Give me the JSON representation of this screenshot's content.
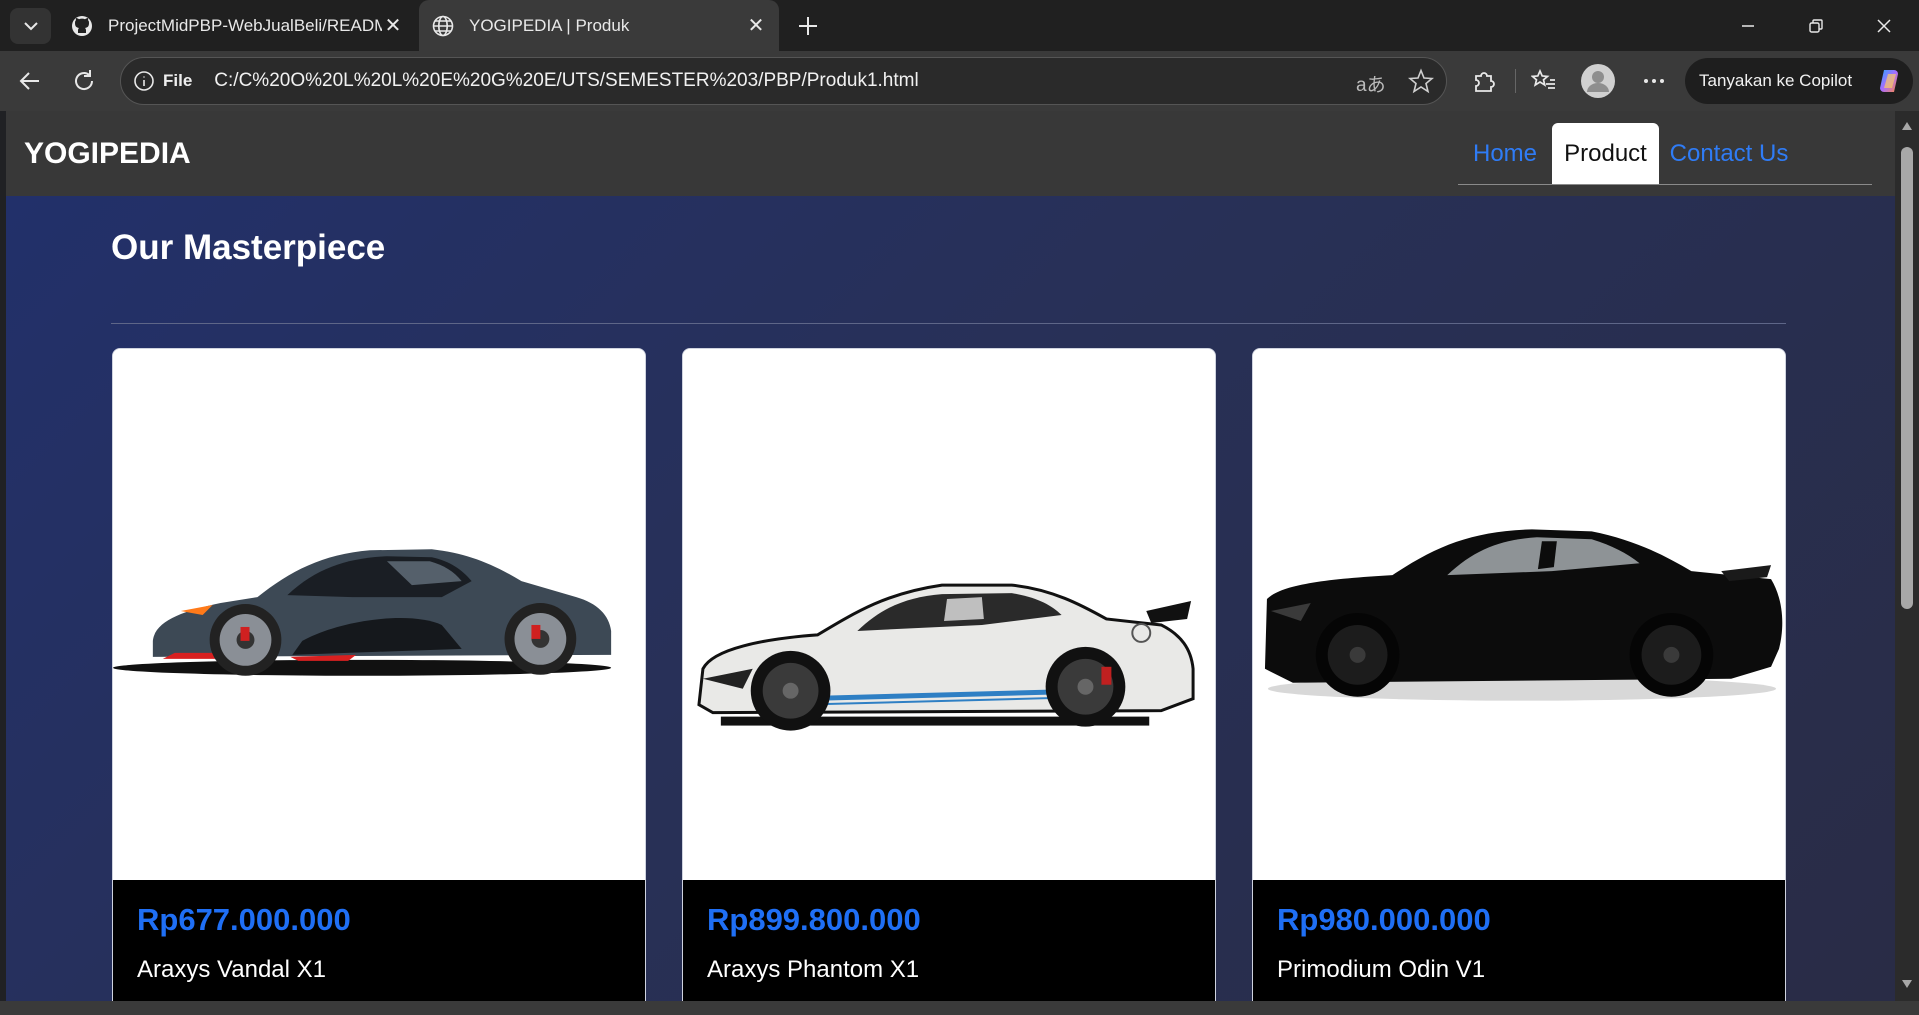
{
  "browser": {
    "tabs": [
      {
        "title": "ProjectMidPBP-WebJualBeli/README",
        "icon": "github-icon",
        "active": false
      },
      {
        "title": "YOGIPEDIA | Produk",
        "icon": "globe-icon",
        "active": true
      }
    ],
    "address": {
      "scheme_label": "File",
      "url": "C:/C%20O%20L%20L%20E%20G%20E/UTS/SEMESTER%203/PBP/Produk1.html"
    },
    "copilot_label": "Tanyakan ke Copilot"
  },
  "site": {
    "brand": "YOGIPEDIA",
    "nav": [
      {
        "label": "Home",
        "active": false
      },
      {
        "label": "Product",
        "active": true
      },
      {
        "label": "Contact Us",
        "active": false
      }
    ],
    "heading": "Our Masterpiece",
    "products": [
      {
        "price": "Rp677.000.000",
        "name": "Araxys Vandal X1",
        "image": "gray-hypercar-image"
      },
      {
        "price": "Rp899.800.000",
        "name": "Araxys Phantom X1",
        "image": "white-muscle-car-image"
      },
      {
        "price": "Rp980.000.000",
        "name": "Primodium Odin V1",
        "image": "black-coupe-image"
      }
    ]
  },
  "colors": {
    "accent": "#1f6ff5",
    "page_bg": "#27305a",
    "nav_bg": "#383838"
  }
}
